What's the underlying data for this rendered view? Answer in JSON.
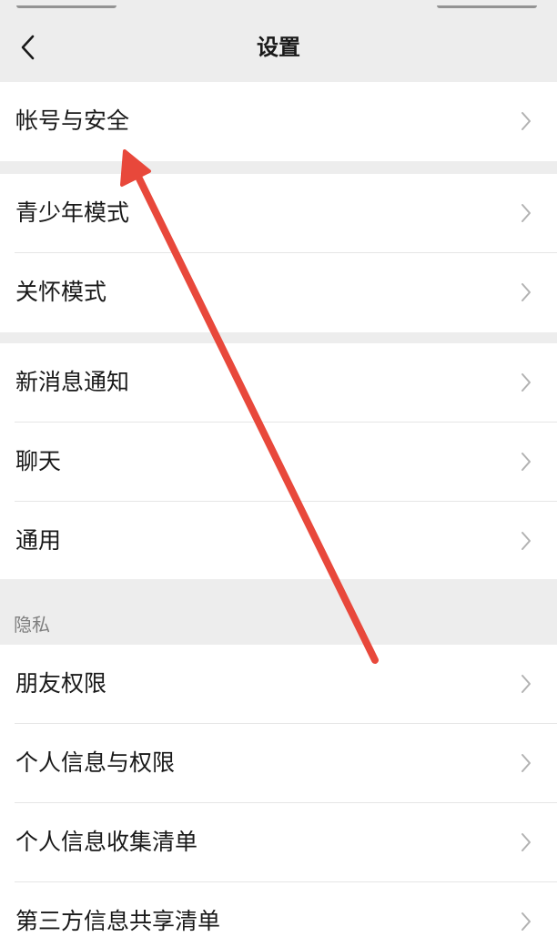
{
  "header": {
    "title": "设置",
    "back_icon": "chevron-left-icon"
  },
  "sections": [
    {
      "items": [
        {
          "label": "帐号与安全"
        }
      ]
    },
    {
      "items": [
        {
          "label": "青少年模式"
        },
        {
          "label": "关怀模式"
        }
      ]
    },
    {
      "items": [
        {
          "label": "新消息通知"
        },
        {
          "label": "聊天"
        },
        {
          "label": "通用"
        }
      ]
    },
    {
      "header": "隐私",
      "items": [
        {
          "label": "朋友权限"
        },
        {
          "label": "个人信息与权限"
        },
        {
          "label": "个人信息收集清单"
        },
        {
          "label": "第三方信息共享清单"
        }
      ]
    }
  ],
  "colors": {
    "background": "#ededed",
    "row_background": "#ffffff",
    "text": "#191919",
    "section_header_text": "#7f7f7f",
    "chevron": "#b2b2b2",
    "annotation_arrow": "#e8483b"
  },
  "annotation": {
    "type": "red-arrow",
    "points_to": "帐号与安全"
  }
}
